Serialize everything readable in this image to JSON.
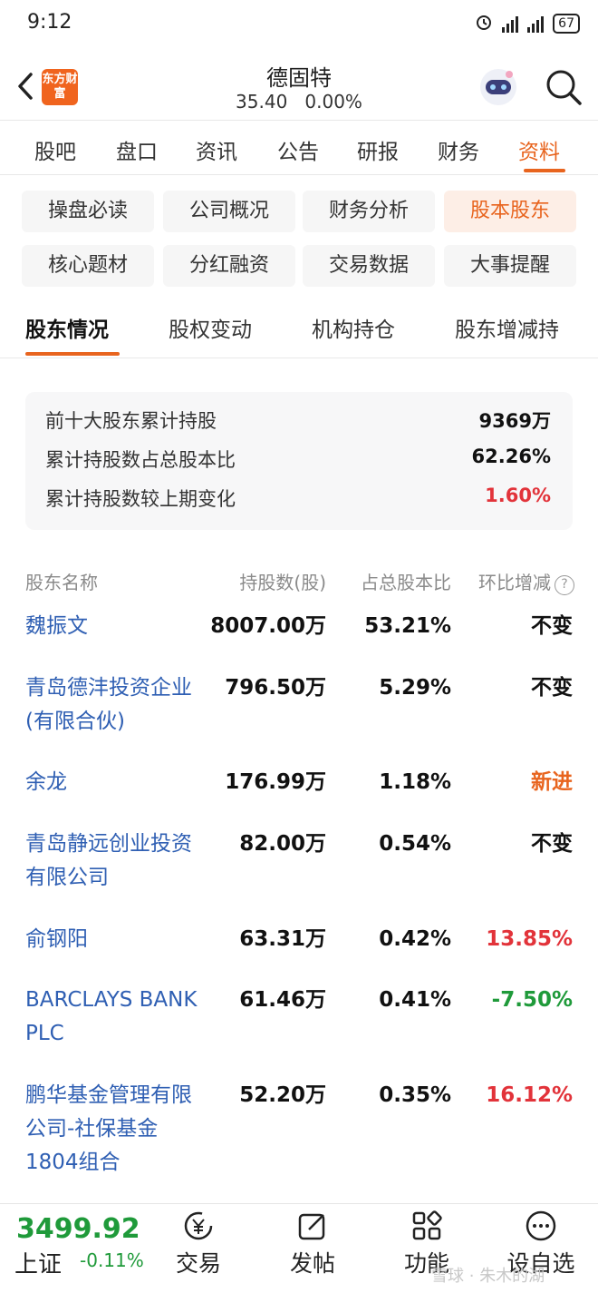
{
  "status_bar": {
    "time": "9:12",
    "battery": "67"
  },
  "header": {
    "logo_text": "东方财富",
    "title": "德固特",
    "price": "35.40",
    "change": "0.00%"
  },
  "main_tabs": [
    "股吧",
    "盘口",
    "资讯",
    "公告",
    "研报",
    "财务",
    "资料"
  ],
  "sub_chips": [
    "操盘必读",
    "公司概况",
    "财务分析",
    "股本股东",
    "核心题材",
    "分红融资",
    "交易数据",
    "大事提醒"
  ],
  "holder_tabs": [
    "股东情况",
    "股权变动",
    "机构持仓",
    "股东增减持"
  ],
  "summary": {
    "rows": [
      {
        "label": "前十大股东累计持股",
        "value": "9369万"
      },
      {
        "label": "累计持股数占总股本比",
        "value": "62.26%"
      },
      {
        "label": "累计持股数较上期变化",
        "value": "1.60%"
      }
    ]
  },
  "table": {
    "headers": {
      "name": "股东名称",
      "shares": "持股数(股)",
      "pct": "占总股本比",
      "chg": "环比增减",
      "help": "?"
    },
    "rows": [
      {
        "name": "魏振文",
        "shares": "8007.00万",
        "pct": "53.21%",
        "chg": "不变"
      },
      {
        "name": "青岛德沣投资企业(有限合伙)",
        "shares": "796.50万",
        "pct": "5.29%",
        "chg": "不变"
      },
      {
        "name": "余龙",
        "shares": "176.99万",
        "pct": "1.18%",
        "chg": "新进"
      },
      {
        "name": "青岛静远创业投资有限公司",
        "shares": "82.00万",
        "pct": "0.54%",
        "chg": "不变"
      },
      {
        "name": "俞钢阳",
        "shares": "63.31万",
        "pct": "0.42%",
        "chg": "13.85%"
      },
      {
        "name": "BARCLAYS BANK PLC",
        "shares": "61.46万",
        "pct": "0.41%",
        "chg": "-7.50%"
      },
      {
        "name": "鹏华基金管理有限公司-社保基金1804组合",
        "shares": "52.20万",
        "pct": "0.35%",
        "chg": "16.12%"
      }
    ]
  },
  "bottom_bar": {
    "index_value": "3499.92",
    "index_name": "上证",
    "index_change": "-0.11%",
    "items": [
      "交易",
      "发帖",
      "功能",
      "设自选"
    ],
    "watermark": "雪球 · 朱木的湖"
  }
}
